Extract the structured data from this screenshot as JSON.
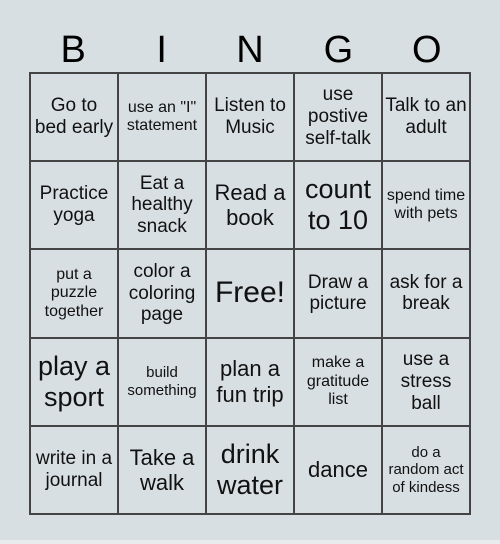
{
  "header": {
    "letters": [
      "B",
      "I",
      "N",
      "G",
      "O"
    ]
  },
  "cells": [
    {
      "text": "Go to bed early",
      "size": "s-md"
    },
    {
      "text": "use an \"I\" statement",
      "size": "s-sm"
    },
    {
      "text": "Listen to Music",
      "size": "s-md"
    },
    {
      "text": "use postive self-talk",
      "size": "s-md"
    },
    {
      "text": "Talk to an adult",
      "size": "s-md"
    },
    {
      "text": "Practice yoga",
      "size": "s-md"
    },
    {
      "text": "Eat a healthy snack",
      "size": "s-md"
    },
    {
      "text": "Read a book",
      "size": "s-lg"
    },
    {
      "text": "count to 10",
      "size": "s-xl"
    },
    {
      "text": "spend time with pets",
      "size": "s-sm"
    },
    {
      "text": "put a puzzle together",
      "size": "s-sm"
    },
    {
      "text": "color a coloring page",
      "size": "s-md"
    },
    {
      "text": "Free!",
      "size": "s-free"
    },
    {
      "text": "Draw a picture",
      "size": "s-md"
    },
    {
      "text": "ask for a break",
      "size": "s-md"
    },
    {
      "text": "play a sport",
      "size": "s-xl"
    },
    {
      "text": "build something",
      "size": "s-xs"
    },
    {
      "text": "plan a fun trip",
      "size": "s-lg"
    },
    {
      "text": "make a gratitude list",
      "size": "s-sm"
    },
    {
      "text": "use a stress ball",
      "size": "s-md"
    },
    {
      "text": "write in a journal",
      "size": "s-md"
    },
    {
      "text": "Take a walk",
      "size": "s-lg"
    },
    {
      "text": "drink water",
      "size": "s-xl"
    },
    {
      "text": "dance",
      "size": "s-lg"
    },
    {
      "text": "do a random act of kindess",
      "size": "s-xs"
    }
  ],
  "colors": {
    "background": "#d8dfe2",
    "border": "#444444",
    "text": "#111111"
  }
}
